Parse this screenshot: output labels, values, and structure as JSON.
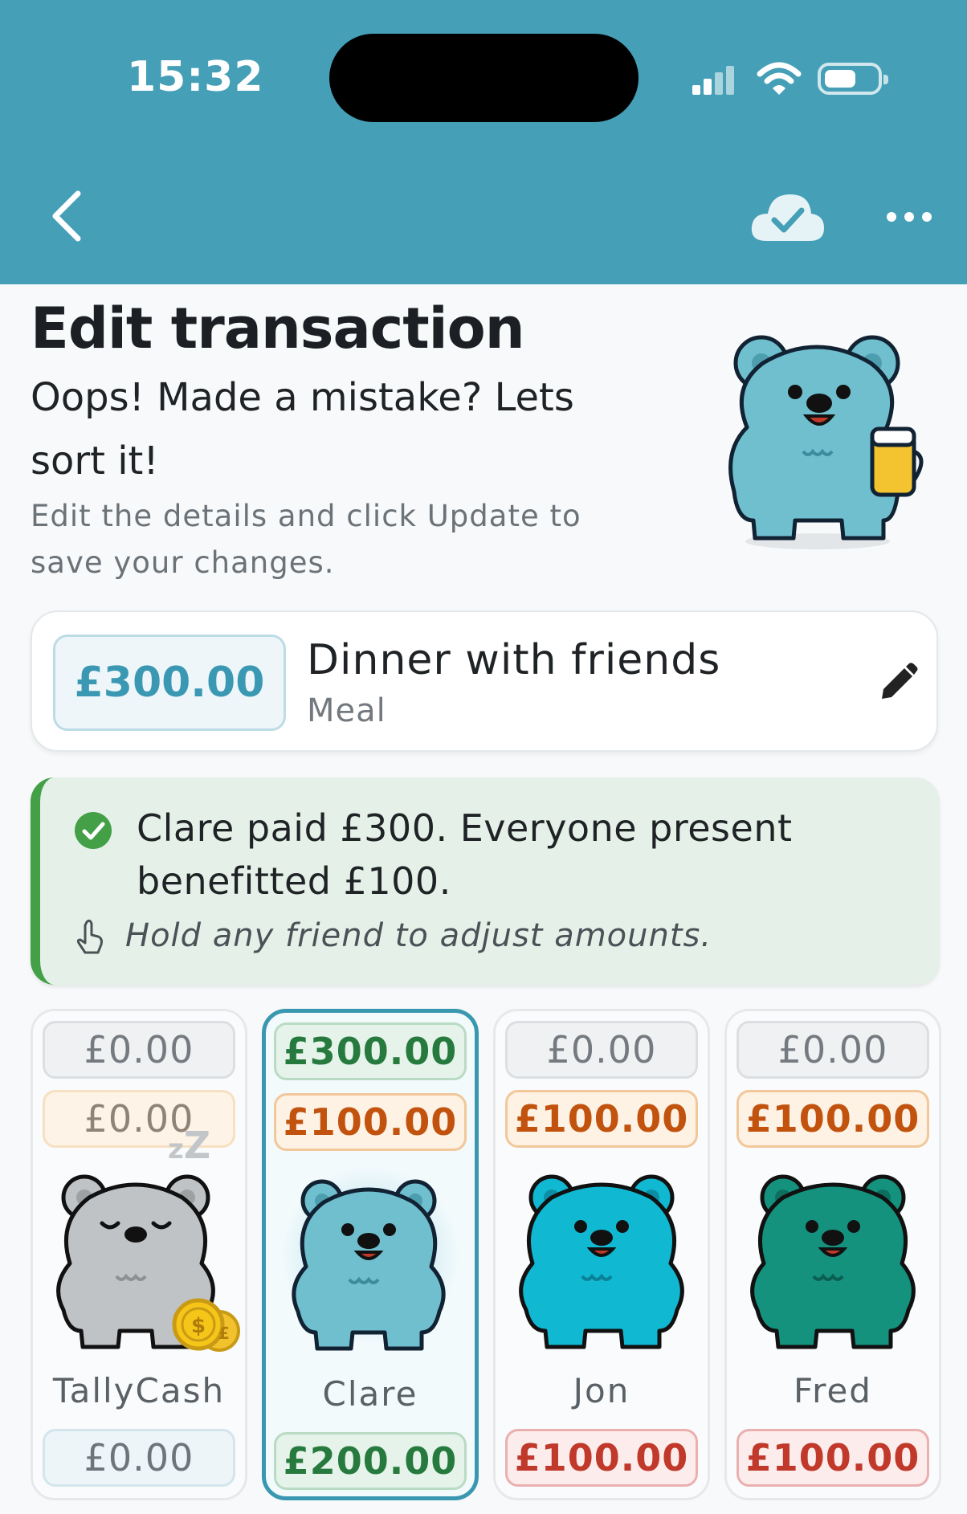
{
  "status_bar": {
    "time": "15:32"
  },
  "header": {
    "back_icon": "chevron-left-icon",
    "sync_icon": "cloud-check-icon",
    "more_icon": "more-horizontal-icon"
  },
  "hero": {
    "title": "Edit transaction",
    "subtitle": "Oops! Made a mistake? Lets sort it!",
    "help": "Edit the details and click Update to save your changes."
  },
  "transaction": {
    "amount": "£300.00",
    "description": "Dinner with friends",
    "category": "Meal",
    "edit_icon": "pencil-icon"
  },
  "banner": {
    "text": "Clare paid £300. Everyone present benefitted £100.",
    "hint": "Hold any friend to adjust amounts.",
    "check_icon": "check-circle-icon",
    "hint_icon": "hand-pointer-icon"
  },
  "friends": [
    {
      "name": "TallyCash",
      "paid": "£0.00",
      "benefit": "£0.00",
      "balance": "£0.00",
      "bear_color": "#bfc3c6"
    },
    {
      "name": "Clare",
      "paid": "£300.00",
      "benefit": "£100.00",
      "balance": "£200.00",
      "bear_color": "#6fbfcf"
    },
    {
      "name": "Jon",
      "paid": "£0.00",
      "benefit": "£100.00",
      "balance": "£100.00",
      "bear_color": "#10b8d2"
    },
    {
      "name": "Fred",
      "paid": "£0.00",
      "benefit": "£100.00",
      "balance": "£100.00",
      "bear_color": "#14927e"
    }
  ],
  "colors": {
    "header": "#449fb7",
    "accent": "#3a98b3",
    "success": "#43a047",
    "danger": "#c0392b",
    "warning": "#c2530e"
  }
}
